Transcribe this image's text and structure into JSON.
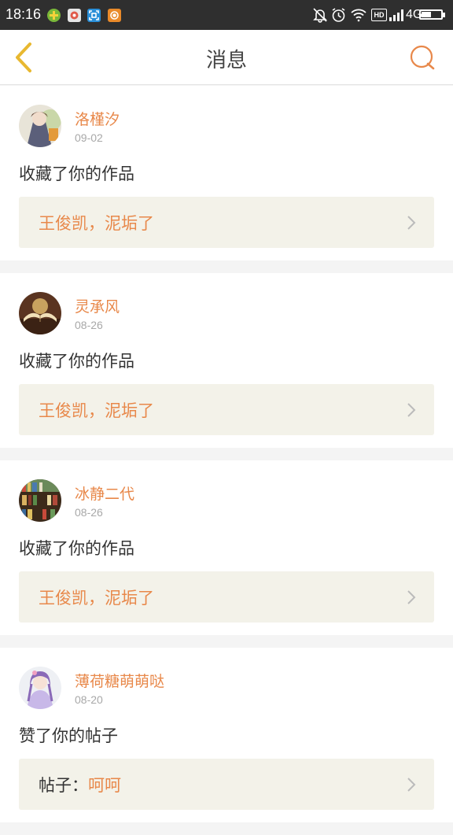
{
  "status_bar": {
    "time": "18:16",
    "network": "4G",
    "hd": "HD",
    "battery_level": 0.5,
    "icons": [
      "app-icon-green",
      "app-icon-gallery",
      "app-icon-scan",
      "app-icon-camera",
      "mute-icon",
      "alarm-icon",
      "wifi-icon",
      "hd-icon",
      "signal-icon",
      "battery-icon"
    ]
  },
  "header": {
    "title": "消息",
    "back_icon": "back-chevron-icon",
    "search_icon": "search-icon"
  },
  "colors": {
    "accent": "#e8884a",
    "back_icon": "#e8b830",
    "ref_background": "#f3f2e9",
    "page_background": "#f4f4f4"
  },
  "messages": [
    {
      "user": "洛槿汐",
      "date": "09-02",
      "action": "收藏了你的作品",
      "ref_prefix": "",
      "ref_title": "王俊凯，泥垢了"
    },
    {
      "user": "灵承风",
      "date": "08-26",
      "action": "收藏了你的作品",
      "ref_prefix": "",
      "ref_title": "王俊凯，泥垢了"
    },
    {
      "user": "冰静二代",
      "date": "08-26",
      "action": "收藏了你的作品",
      "ref_prefix": "",
      "ref_title": "王俊凯，泥垢了"
    },
    {
      "user": "薄荷糖萌萌哒",
      "date": "08-20",
      "action": "赞了你的帖子",
      "ref_prefix": "帖子：",
      "ref_title": "呵呵"
    }
  ]
}
